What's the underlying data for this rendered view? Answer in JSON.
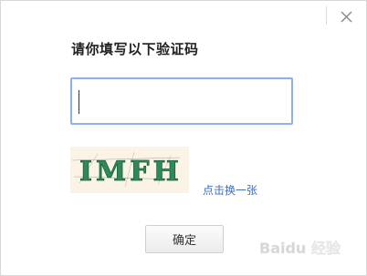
{
  "dialog": {
    "title": "请你填写以下验证码",
    "input": {
      "value": "",
      "placeholder": ""
    },
    "captcha": {
      "text": "IMFH",
      "colors": {
        "ink": "#2e8b57",
        "background": "#fbf3e6",
        "noise": "#5a6a5a"
      }
    },
    "refresh_label": "点击换一张",
    "confirm_label": "确定",
    "close_icon": "close-icon"
  },
  "watermark": {
    "text": "Baidu 经验"
  }
}
